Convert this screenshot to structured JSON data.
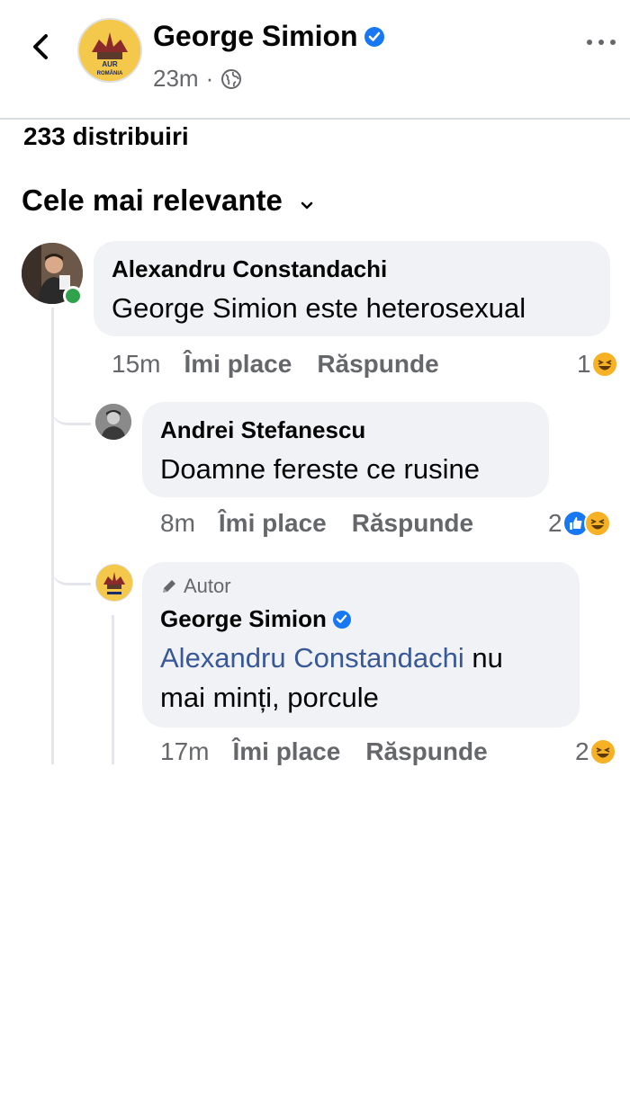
{
  "header": {
    "page_name": "George Simion",
    "time": "23m",
    "separator": "·",
    "privacy_icon": "globe-icon",
    "avatar_text_top": "AUR",
    "avatar_text_bottom": "ROMÂNIA"
  },
  "shares": "233 distribuiri",
  "sort_label": "Cele mai relevante",
  "comments": [
    {
      "author": "Alexandru Constandachi",
      "text": "George Simion este heterosexual",
      "time": "15m",
      "like_label": "Îmi place",
      "reply_label": "Răspunde",
      "reaction_count": "1",
      "reactions": [
        "haha"
      ]
    },
    {
      "author": "Andrei Stefanescu",
      "text": "Doamne fereste ce rusine",
      "time": "8m",
      "like_label": "Îmi place",
      "reply_label": "Răspunde",
      "reaction_count": "2",
      "reactions": [
        "like",
        "haha"
      ]
    },
    {
      "author_badge": "Autor",
      "author": "George Simion",
      "mention": "Alexandru Constandachi",
      "text_line1_rest": " nu",
      "text_line2": "mai minți, porcule",
      "time": "17m",
      "like_label": "Îmi place",
      "reply_label": "Răspunde",
      "reaction_count": "2",
      "reactions": [
        "haha"
      ]
    }
  ],
  "colors": {
    "verified_blue": "#1877f2",
    "bubble": "#f0f2f5",
    "secondary_text": "#65676b",
    "mention": "#385898",
    "online": "#31a24c"
  }
}
